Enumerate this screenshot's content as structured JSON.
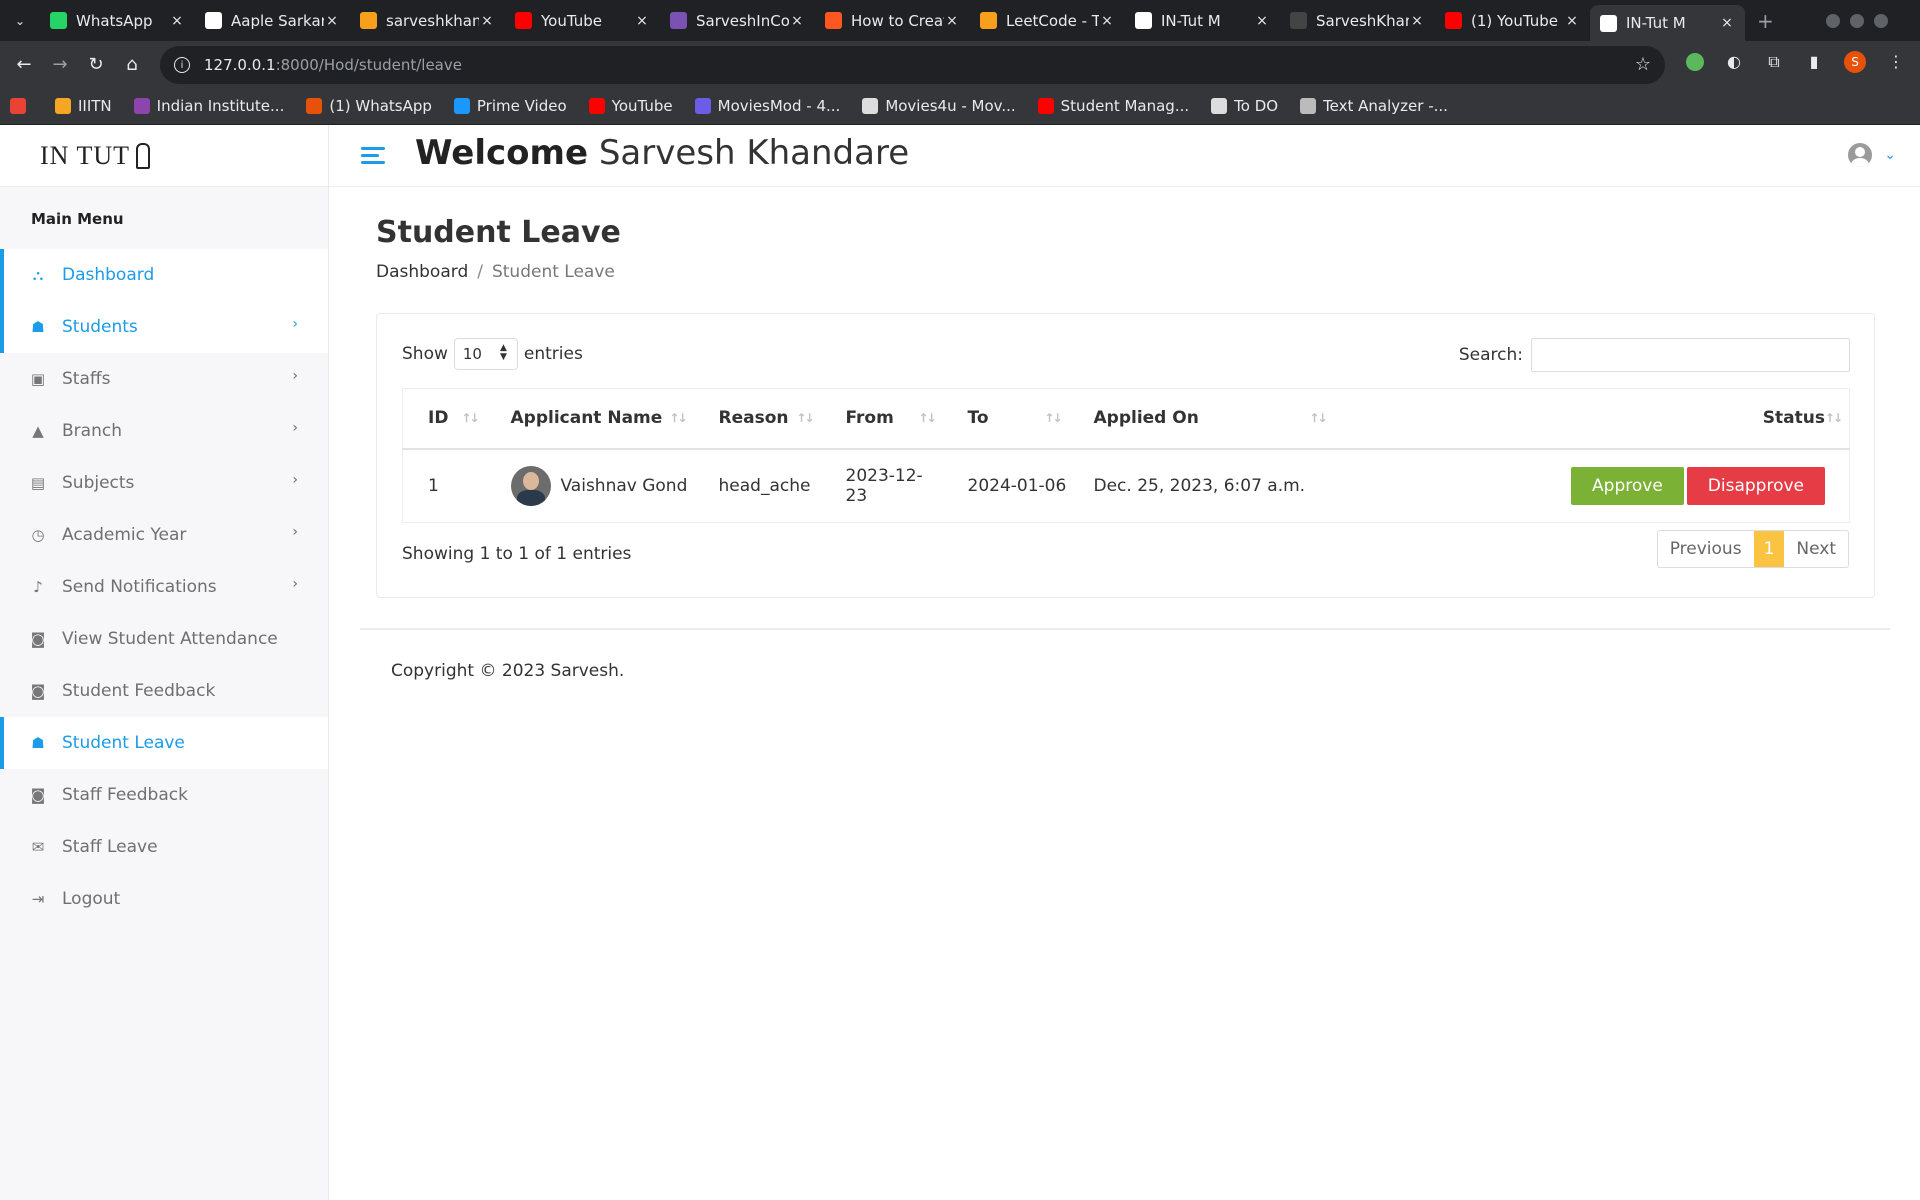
{
  "browser": {
    "tabs": [
      {
        "title": "WhatsApp",
        "favicon_color": "#25d366",
        "active": false
      },
      {
        "title": "Aaple Sarkar",
        "favicon_color": "#ffffff",
        "active": false
      },
      {
        "title": "sarveshkhandare",
        "favicon_color": "#f89f1b",
        "active": false
      },
      {
        "title": "YouTube",
        "favicon_color": "#ff0000",
        "active": false
      },
      {
        "title": "SarveshInCode",
        "favicon_color": "#7952b3",
        "active": false
      },
      {
        "title": "How to Create",
        "favicon_color": "#ff5722",
        "active": false
      },
      {
        "title": "LeetCode - The",
        "favicon_color": "#f89f1b",
        "active": false
      },
      {
        "title": "IN-Tut M",
        "favicon_color": "#ffffff",
        "active": false
      },
      {
        "title": "SarveshKhandare",
        "favicon_color": "#444444",
        "active": false
      },
      {
        "title": "(1) YouTube",
        "favicon_color": "#ff0000",
        "active": false
      },
      {
        "title": "IN-Tut M",
        "favicon_color": "#ffffff",
        "active": true
      }
    ],
    "url_host": "127.0.0.1",
    "url_path": ":8000/Hod/student/leave",
    "profile_initial": "S",
    "bookmarks": [
      {
        "label": "",
        "color": "#ea4335"
      },
      {
        "label": "IIITN",
        "color": "#f5a623"
      },
      {
        "label": "Indian Institute...",
        "color": "#8e44ad"
      },
      {
        "label": "(1) WhatsApp",
        "color": "#e8510a"
      },
      {
        "label": "Prime Video",
        "color": "#1a98ff"
      },
      {
        "label": "YouTube",
        "color": "#ff0000"
      },
      {
        "label": "MoviesMod - 4...",
        "color": "#6c5ce7"
      },
      {
        "label": "Movies4u - Mov...",
        "color": "#dddddd"
      },
      {
        "label": "Student Manag...",
        "color": "#ff0000"
      },
      {
        "label": "To DO",
        "color": "#dddddd"
      },
      {
        "label": "Text Analyzer -...",
        "color": "#bbbbbb"
      }
    ]
  },
  "app": {
    "logo_text": "IN TUT",
    "welcome_bold": "Welcome",
    "welcome_name": "Sarvesh Khandare",
    "accent_color": "#1b9be8",
    "sidebar": {
      "title": "Main Menu",
      "items": [
        {
          "label": "Dashboard",
          "icon": "dashboard-icon",
          "glyph": "⛬",
          "has_chevron": false,
          "active": true
        },
        {
          "label": "Students",
          "icon": "student-icon",
          "glyph": "☗",
          "has_chevron": true,
          "active": true
        },
        {
          "label": "Staffs",
          "icon": "staff-icon",
          "glyph": "▣",
          "has_chevron": true,
          "active": false
        },
        {
          "label": "Branch",
          "icon": "graduation-cap-icon",
          "glyph": "▲",
          "has_chevron": true,
          "active": false
        },
        {
          "label": "Subjects",
          "icon": "subjects-icon",
          "glyph": "▤",
          "has_chevron": true,
          "active": false
        },
        {
          "label": "Academic Year",
          "icon": "clock-icon",
          "glyph": "◷",
          "has_chevron": true,
          "active": false
        },
        {
          "label": "Send Notifications",
          "icon": "bell-icon",
          "glyph": "♪",
          "has_chevron": true,
          "active": false
        },
        {
          "label": "View Student Attendance",
          "icon": "comments-icon",
          "glyph": "◙",
          "has_chevron": false,
          "active": false
        },
        {
          "label": "Student Feedback",
          "icon": "comments-icon",
          "glyph": "◙",
          "has_chevron": false,
          "active": false
        },
        {
          "label": "Student Leave",
          "icon": "student-icon",
          "glyph": "☗",
          "has_chevron": false,
          "active": true
        },
        {
          "label": "Staff Feedback",
          "icon": "comments-icon",
          "glyph": "◙",
          "has_chevron": false,
          "active": false
        },
        {
          "label": "Staff Leave",
          "icon": "envelope-icon",
          "glyph": "✉",
          "has_chevron": false,
          "active": false
        },
        {
          "label": "Logout",
          "icon": "logout-icon",
          "glyph": "⇥",
          "has_chevron": false,
          "active": false
        }
      ]
    },
    "page": {
      "title": "Student Leave",
      "breadcrumb": {
        "root": "Dashboard",
        "current": "Student Leave"
      },
      "datatable": {
        "show_label": "Show",
        "entries_label": "entries",
        "page_size": "10",
        "search_label": "Search:",
        "search_value": "",
        "columns": [
          "ID",
          "Applicant Name",
          "Reason",
          "From",
          "To",
          "Applied On",
          "Status"
        ],
        "rows": [
          {
            "id": "1",
            "name": "Vaishnav Gond",
            "reason": "head_ache",
            "from": "2023-12-23",
            "to": "2024-01-06",
            "applied_on": "Dec. 25, 2023, 6:07 a.m."
          }
        ],
        "approve_label": "Approve",
        "disapprove_label": "Disapprove",
        "info": "Showing 1 to 1 of 1 entries",
        "pager": {
          "previous": "Previous",
          "current": "1",
          "next": "Next"
        }
      }
    },
    "footer": "Copyright © 2023 Sarvesh."
  }
}
